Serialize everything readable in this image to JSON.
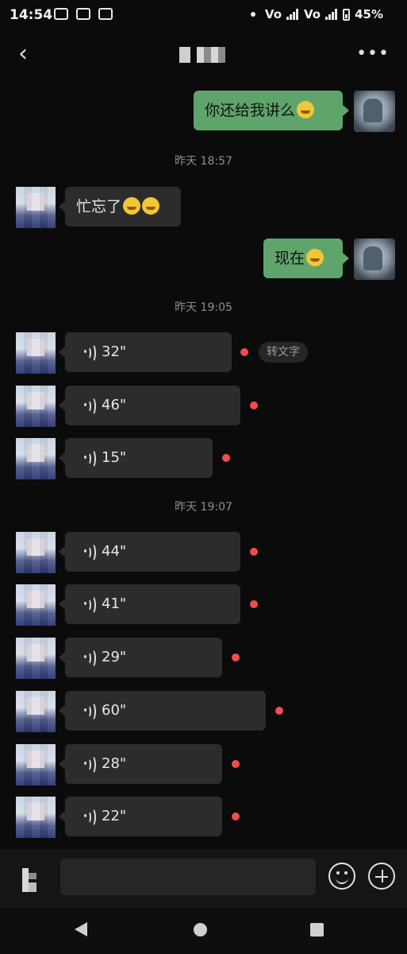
{
  "status_bar": {
    "time": "14:54",
    "battery": "45%",
    "net1": "Vo",
    "net2": "Vo"
  },
  "header": {
    "back_label": "‹",
    "more_label": "•••"
  },
  "messages": {
    "m1": {
      "text": "你还给我讲么"
    },
    "ts1": "昨天 18:57",
    "m2": {
      "text": "忙忘了"
    },
    "m3": {
      "text": "现在"
    },
    "ts2": "昨天 19:05",
    "ts3": "昨天 19:07",
    "voice_to_text": "转文字",
    "voices": [
      "32\"",
      "46\"",
      "15\"",
      "44\"",
      "41\"",
      "29\"",
      "60\"",
      "28\"",
      "22\""
    ]
  },
  "colors": {
    "accent_green": "#5fa56b",
    "unread_red": "#f14d4f",
    "bubble_dark": "#2c2c2c"
  }
}
